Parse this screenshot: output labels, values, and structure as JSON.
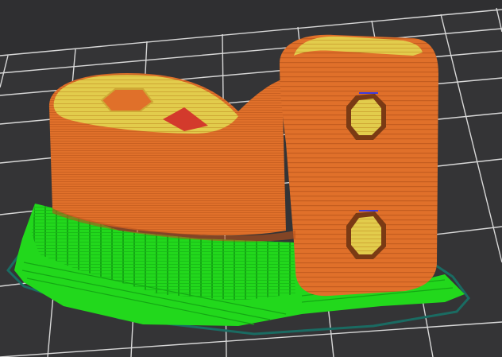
{
  "viewer": {
    "background_color": "#2f2f31",
    "bed_color": "#343436",
    "bed_grid_line_color": "#d8d8d8",
    "skirt_color": "#1a6b62"
  },
  "model": {
    "feature_colors": {
      "perimeter": "#e0702a",
      "perimeter_dark": "#c45d20",
      "top_solid_infill": "#e2cc4c",
      "solid_infill": "#d33a2c",
      "support_material": "#22d81c",
      "support_dark": "#14a814",
      "travel": "#3a3adf"
    }
  }
}
